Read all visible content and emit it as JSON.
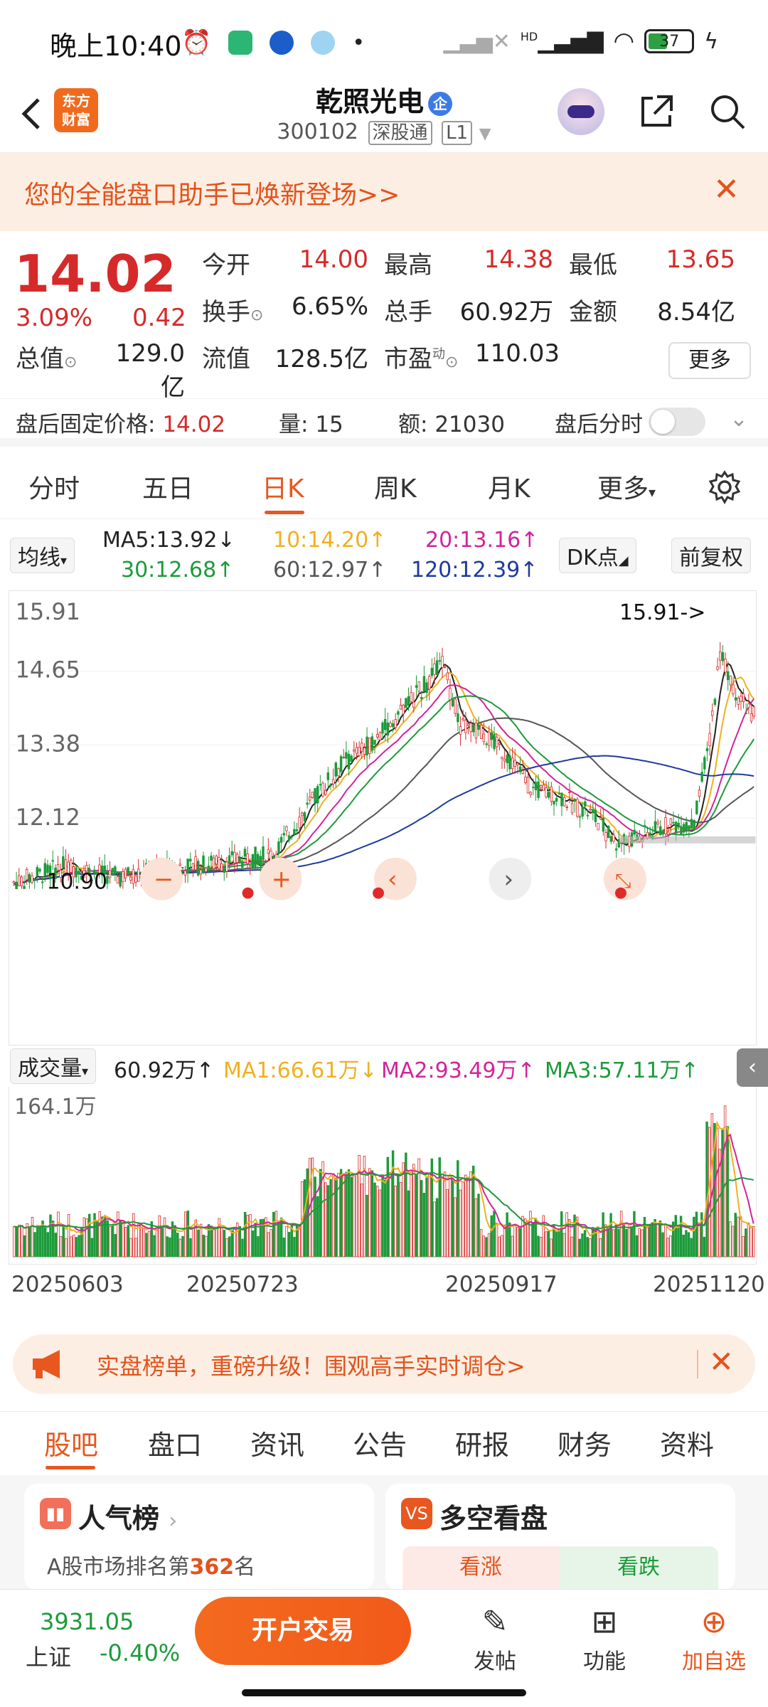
{
  "status_bar": {
    "time": "晚上10:40",
    "battery": "37",
    "network": "HD"
  },
  "header": {
    "logo_text": "东方财富",
    "stock_name": "乾照光电",
    "badge": "企",
    "stock_code": "300102",
    "tag_connect": "深股通",
    "tag_level": "L1"
  },
  "banner": {
    "text": "您的全能盘口助手已焕新登场>>",
    "close": "✕"
  },
  "quote": {
    "price": "14.02",
    "change_pct": "3.09%",
    "change": "0.42",
    "rows": [
      [
        {
          "label": "今开",
          "value": "14.00",
          "color": "red"
        },
        {
          "label": "最高",
          "value": "14.38",
          "color": "red"
        },
        {
          "label": "最低",
          "value": "13.65",
          "color": "red"
        }
      ],
      [
        {
          "label": "换手",
          "value": "6.65%",
          "color": "plain"
        },
        {
          "label": "总手",
          "value": "60.92万",
          "color": "plain"
        },
        {
          "label": "金额",
          "value": "8.54亿",
          "color": "plain"
        }
      ],
      [
        {
          "label": "总值",
          "value": "129.0亿",
          "color": "plain"
        },
        {
          "label": "流值",
          "value": "128.5亿",
          "color": "plain"
        },
        {
          "label": "市盈",
          "value": "110.03",
          "color": "plain"
        }
      ]
    ],
    "pe_superscript": "动",
    "more_label": "更多"
  },
  "after_hours": {
    "price_label": "盘后固定价格:",
    "price_value": "14.02",
    "vol_label": "量:",
    "vol_value": "15",
    "amt_label": "额:",
    "amt_value": "21030",
    "timeshare_label": "盘后分时"
  },
  "period_tabs": [
    "分时",
    "五日",
    "日K",
    "周K",
    "月K",
    "更多"
  ],
  "ma_row": {
    "select_label": "均线",
    "items": [
      {
        "text": "MA5:13.92",
        "arrow": "↓",
        "color": "#222222"
      },
      {
        "text": "10:14.20",
        "arrow": "↑",
        "color": "#f0b020"
      },
      {
        "text": "20:13.16",
        "arrow": "↑",
        "color": "#d2249b"
      },
      {
        "text": "30:12.68",
        "arrow": "↑",
        "color": "#1c9b3a"
      },
      {
        "text": "60:12.97",
        "arrow": "↑",
        "color": "#555555"
      },
      {
        "text": "120:12.39",
        "arrow": "↑",
        "color": "#1e3a9f"
      }
    ],
    "dk_label": "DK点",
    "adjust_label": "前复权"
  },
  "chart_data": {
    "type": "candlestick",
    "y_ticks": [
      "15.91",
      "14.65",
      "13.38",
      "12.12"
    ],
    "y_min": 10.9,
    "y_max": 15.91,
    "high_marker": "15.91->",
    "low_marker": "10.90",
    "volume_max_label": "164.1万",
    "dates": [
      "20250603",
      "20250723",
      "20250917",
      "20251120"
    ],
    "colors": {
      "up": "#d62a2a",
      "down": "#1c9b3a",
      "ma5": "#222222",
      "ma10": "#f0b020",
      "ma20": "#d2249b",
      "ma30": "#1c9b3a",
      "ma60": "#555555",
      "ma120": "#1e3a9f"
    }
  },
  "volume_header": {
    "select_label": "成交量",
    "value": "60.92万",
    "value_arrow": "↑",
    "ma1": "MA1:66.61万",
    "ma1_arrow": "↓",
    "ma2": "MA2:93.49万",
    "ma2_arrow": "↑",
    "ma3": "MA3:57.11万",
    "ma3_arrow": "↑"
  },
  "promo": {
    "text": "实盘榜单，重磅升级！围观高手实时调仓>",
    "close": "✕"
  },
  "content_tabs": [
    "股吧",
    "盘口",
    "资讯",
    "公告",
    "研报",
    "财务",
    "资料"
  ],
  "cards": {
    "popularity": {
      "title": "人气榜",
      "sub_prefix": "A股市场排名第",
      "rank": "362",
      "sub_suffix": "名"
    },
    "longshort": {
      "title": "多空看盘",
      "bull": "看涨",
      "bear": "看跌"
    }
  },
  "bottom_bar": {
    "index_value": "3931.05",
    "index_name": "上证",
    "index_change": "-0.40%",
    "trade_button": "开户交易",
    "post": "发帖",
    "functions": "功能",
    "add_watch": "加自选"
  }
}
